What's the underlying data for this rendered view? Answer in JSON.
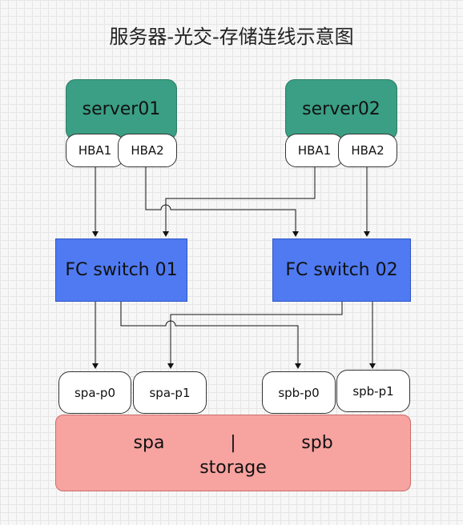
{
  "title": "服务器-光交-存储连线示意图",
  "servers": [
    {
      "name": "server01",
      "ports": [
        "HBA1",
        "HBA2"
      ]
    },
    {
      "name": "server02",
      "ports": [
        "HBA1",
        "HBA2"
      ]
    }
  ],
  "switches": [
    "FC switch 01",
    "FC switch 02"
  ],
  "storage_ports": [
    "spa-p0",
    "spa-p1",
    "spb-p0",
    "spb-p1"
  ],
  "storage": {
    "spa": "spa",
    "separator": "|",
    "spb": "spb",
    "name": "storage"
  },
  "colors": {
    "server_fill": "#3a9f84",
    "switch_fill": "#4f7af2",
    "storage_fill": "#f7a3a0",
    "line": "#111111"
  }
}
